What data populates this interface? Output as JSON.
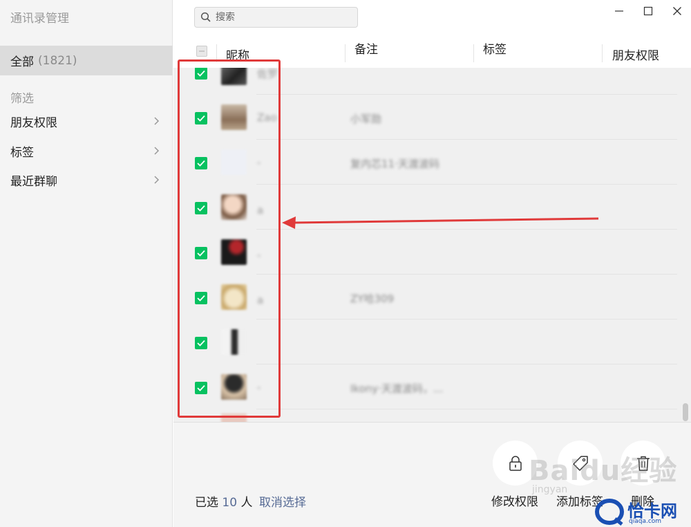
{
  "app_title": "通讯录管理",
  "sidebar": {
    "all_label": "全部",
    "all_count": "(1821)",
    "filter_label": "筛选",
    "items": [
      {
        "label": "朋友权限"
      },
      {
        "label": "标签"
      },
      {
        "label": "最近群聊"
      }
    ]
  },
  "search": {
    "placeholder": "搜索"
  },
  "columns": {
    "nickname": "昵称",
    "note": "备注",
    "tags": "标签",
    "permission": "朋友权限"
  },
  "rows": [
    {
      "nickname": "佐罗",
      "note": "",
      "checked": true
    },
    {
      "nickname": "Zao",
      "note": "小军勋",
      "checked": true
    },
    {
      "nickname": "-",
      "note": "复内芯11·天渡波码",
      "checked": true
    },
    {
      "nickname": "a",
      "note": "",
      "checked": true
    },
    {
      "nickname": "-",
      "note": "",
      "checked": true
    },
    {
      "nickname": "a",
      "note": "ZY哈309",
      "checked": true
    },
    {
      "nickname": "",
      "note": "",
      "checked": true
    },
    {
      "nickname": "-",
      "note": "Ikony·天渡波码，...",
      "checked": true
    }
  ],
  "footer": {
    "selected_prefix": "已选",
    "selected_count": "10",
    "selected_suffix": "人",
    "cancel_label": "取消选择",
    "actions": [
      {
        "label": "修改权限",
        "icon": "lock-icon"
      },
      {
        "label": "添加标签",
        "icon": "tag-icon"
      },
      {
        "label": "删除",
        "icon": "trash-icon"
      }
    ]
  },
  "watermarks": {
    "baidu": "Baidu经验",
    "jingyan": "jingyan",
    "brand": "恰卡网",
    "site": "qiaqa.com"
  },
  "colors": {
    "accent_green": "#07c160",
    "link_blue": "#576b95",
    "annotation_red": "#e03a3a"
  }
}
